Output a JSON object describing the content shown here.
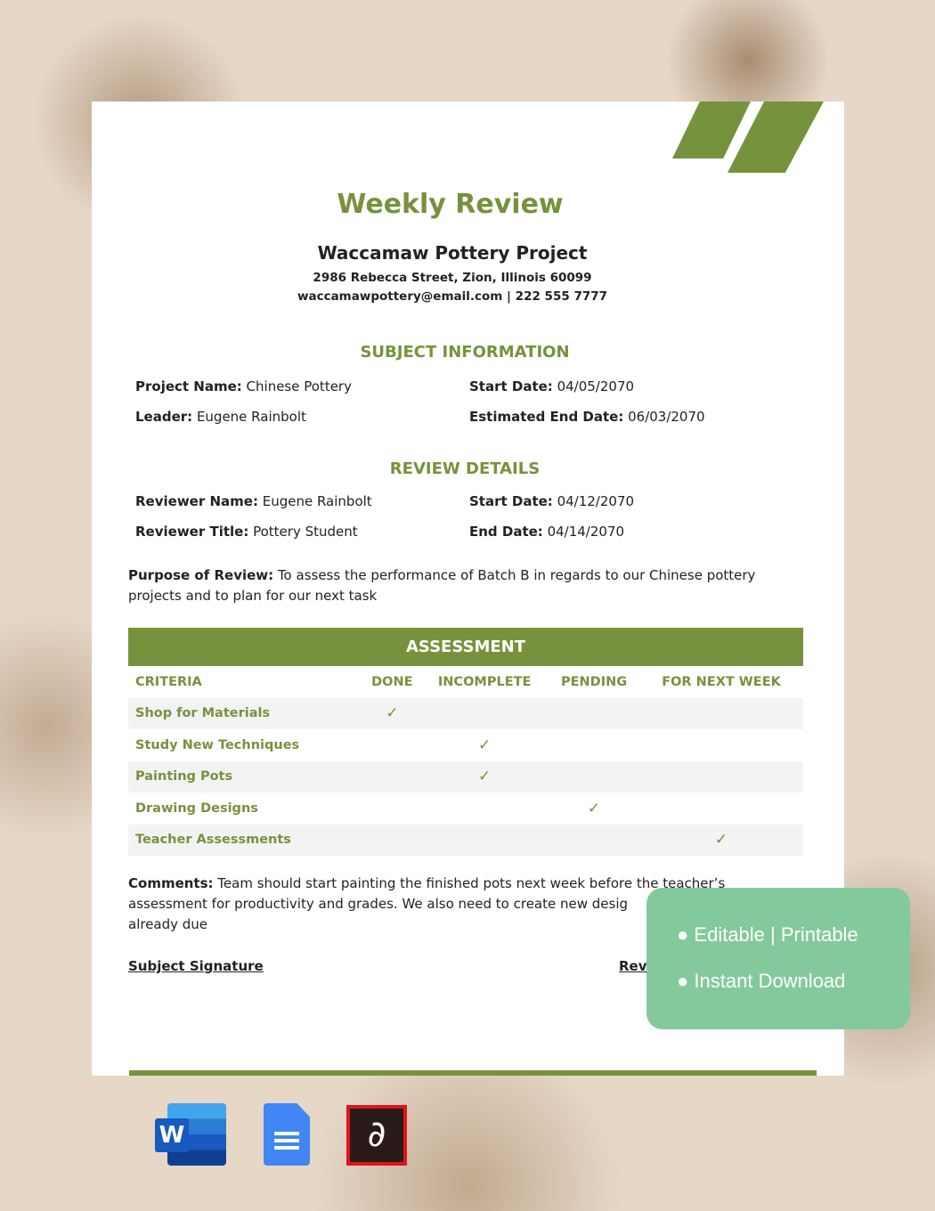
{
  "document": {
    "title": "Weekly Review",
    "org_name": "Waccamaw Pottery Project",
    "address": "2986 Rebecca Street, Zion, Illinois 60099",
    "contact": "waccamawpottery@email.com | 222 555 7777",
    "subject_heading": "SUBJECT INFORMATION",
    "subject": [
      {
        "label": "Project Name:",
        "value": " Chinese Pottery"
      },
      {
        "label": "Start Date:",
        "value": " 04/05/2070"
      },
      {
        "label": "Leader:",
        "value": " Eugene Rainbolt"
      },
      {
        "label": "Estimated End Date:",
        "value": " 06/03/2070"
      }
    ],
    "review_heading": "REVIEW DETAILS",
    "review": [
      {
        "label": "Reviewer Name:",
        "value": " Eugene Rainbolt"
      },
      {
        "label": "Start Date:",
        "value": " 04/12/2070"
      },
      {
        "label": "Reviewer Title:",
        "value": " Pottery Student"
      },
      {
        "label": "End Date:",
        "value": " 04/14/2070"
      }
    ],
    "purpose_label": "Purpose of Review:",
    "purpose": " To assess the performance of Batch B in regards to our Chinese pottery projects and to plan for our next task",
    "assessment": {
      "title": "ASSESSMENT",
      "columns": [
        "CRITERIA",
        "DONE",
        "INCOMPLETE",
        "PENDING",
        "FOR NEXT WEEK"
      ],
      "rows": [
        {
          "criteria": "Shop for Materials",
          "status": "DONE"
        },
        {
          "criteria": "Study New Techniques",
          "status": "INCOMPLETE"
        },
        {
          "criteria": "Painting Pots",
          "status": "INCOMPLETE"
        },
        {
          "criteria": "Drawing Designs",
          "status": "PENDING"
        },
        {
          "criteria": "Teacher Assessments",
          "status": "FOR NEXT WEEK"
        }
      ],
      "check": "✓"
    },
    "comments_label": "Comments:",
    "comments": " Team should start painting the finished pots next week before the teacher’s assessment for productivity and grades. We also need to create new desig",
    "comments_end": "already due",
    "subject_signature": "Subject Signature",
    "reviewer_signature": "Rev"
  },
  "badge": {
    "items": [
      "Editable | Printable",
      "Instant Download"
    ]
  },
  "formats": {
    "icons": [
      "word-icon",
      "google-docs-icon",
      "pdf-icon"
    ],
    "word_letter": "W"
  },
  "colors": {
    "accent": "#76923c",
    "badge": "#83c99c",
    "pdf": "#e0141e"
  }
}
